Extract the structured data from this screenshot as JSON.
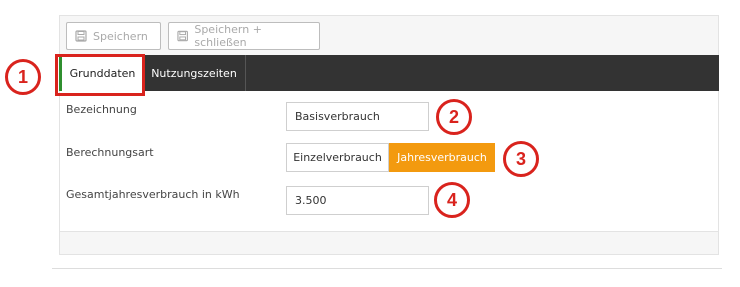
{
  "toolbar": {
    "save_label": "Speichern",
    "save_close_label": "Speichern + schließen"
  },
  "tabs": [
    {
      "label": "Grunddaten",
      "active": true
    },
    {
      "label": "Nutzungszeiten",
      "active": false
    }
  ],
  "form": {
    "bezeichnung_label": "Bezeichnung",
    "bezeichnung_value": "Basisverbrauch",
    "berechnungsart_label": "Berechnungsart",
    "berechnungsart_options": [
      "Einzelverbrauch",
      "Jahresverbrauch"
    ],
    "berechnungsart_selected": "Jahresverbrauch",
    "gesamt_label": "Gesamtjahresverbrauch in kWh",
    "gesamt_value": "3.500"
  },
  "annotations": [
    "1",
    "2",
    "3",
    "4"
  ],
  "colors": {
    "accent": "#f39a0f",
    "tabbar": "#333333",
    "annotation": "#d9231d",
    "active_tab_marker": "#2f8f2f"
  }
}
